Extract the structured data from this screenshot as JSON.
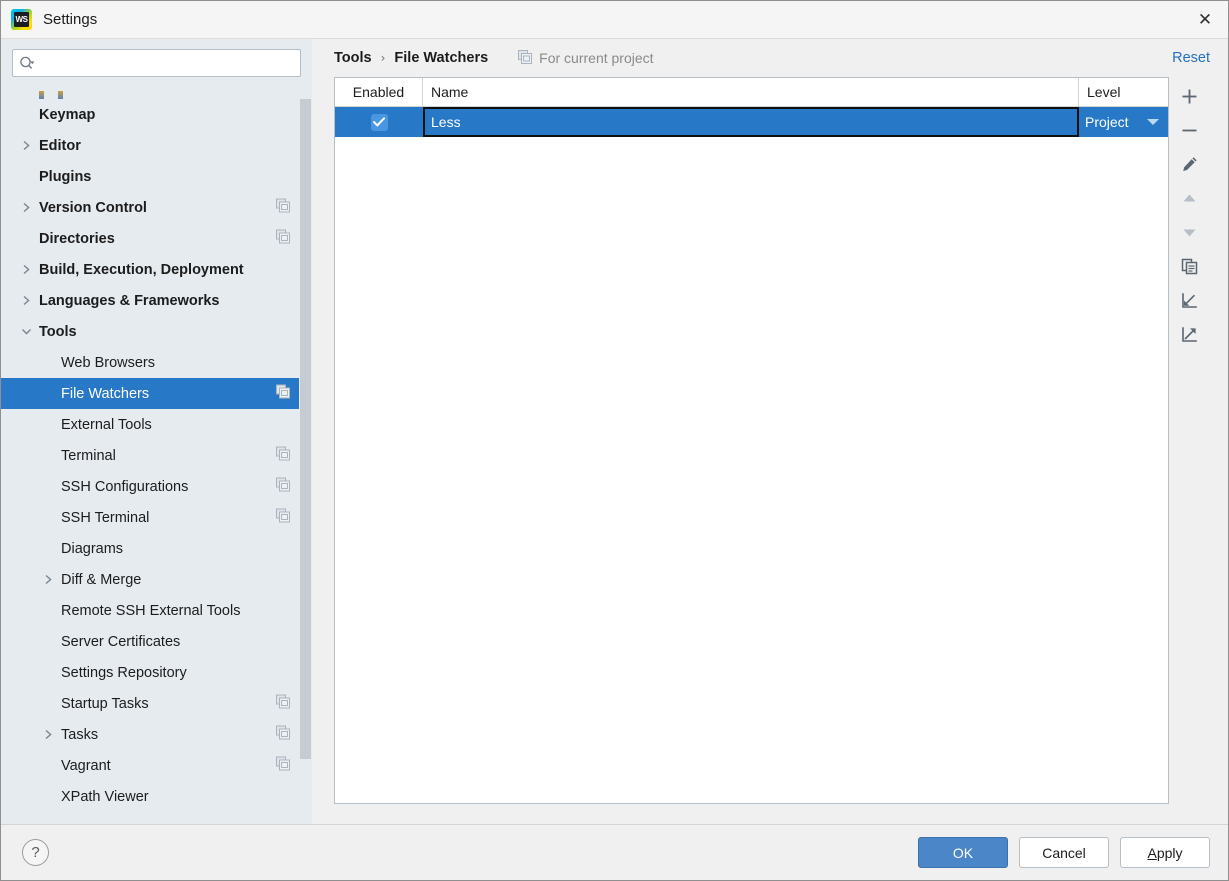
{
  "window": {
    "title": "Settings",
    "logo_text": "WS",
    "close_label": "✕"
  },
  "sidebar": {
    "search": {
      "value": "",
      "placeholder": ""
    },
    "items": [
      {
        "label": "Keymap",
        "level": 0,
        "bold": true,
        "arrow": "none",
        "copy": false
      },
      {
        "label": "Editor",
        "level": 0,
        "bold": true,
        "arrow": "right",
        "copy": false
      },
      {
        "label": "Plugins",
        "level": 0,
        "bold": true,
        "arrow": "none",
        "copy": false
      },
      {
        "label": "Version Control",
        "level": 0,
        "bold": true,
        "arrow": "right",
        "copy": true
      },
      {
        "label": "Directories",
        "level": 0,
        "bold": true,
        "arrow": "none",
        "copy": true
      },
      {
        "label": "Build, Execution, Deployment",
        "level": 0,
        "bold": true,
        "arrow": "right",
        "copy": false
      },
      {
        "label": "Languages & Frameworks",
        "level": 0,
        "bold": true,
        "arrow": "right",
        "copy": false
      },
      {
        "label": "Tools",
        "level": 0,
        "bold": true,
        "arrow": "down",
        "copy": false
      },
      {
        "label": "Web Browsers",
        "level": 1,
        "bold": false,
        "arrow": "none",
        "copy": false
      },
      {
        "label": "File Watchers",
        "level": 1,
        "bold": false,
        "arrow": "none",
        "copy": true,
        "selected": true
      },
      {
        "label": "External Tools",
        "level": 1,
        "bold": false,
        "arrow": "none",
        "copy": false
      },
      {
        "label": "Terminal",
        "level": 1,
        "bold": false,
        "arrow": "none",
        "copy": true
      },
      {
        "label": "SSH Configurations",
        "level": 1,
        "bold": false,
        "arrow": "none",
        "copy": true
      },
      {
        "label": "SSH Terminal",
        "level": 1,
        "bold": false,
        "arrow": "none",
        "copy": true
      },
      {
        "label": "Diagrams",
        "level": 1,
        "bold": false,
        "arrow": "none",
        "copy": false
      },
      {
        "label": "Diff & Merge",
        "level": 1,
        "bold": false,
        "arrow": "right",
        "copy": false
      },
      {
        "label": "Remote SSH External Tools",
        "level": 1,
        "bold": false,
        "arrow": "none",
        "copy": false
      },
      {
        "label": "Server Certificates",
        "level": 1,
        "bold": false,
        "arrow": "none",
        "copy": false
      },
      {
        "label": "Settings Repository",
        "level": 1,
        "bold": false,
        "arrow": "none",
        "copy": false
      },
      {
        "label": "Startup Tasks",
        "level": 1,
        "bold": false,
        "arrow": "none",
        "copy": true
      },
      {
        "label": "Tasks",
        "level": 1,
        "bold": false,
        "arrow": "right",
        "copy": true
      },
      {
        "label": "Vagrant",
        "level": 1,
        "bold": false,
        "arrow": "none",
        "copy": true
      },
      {
        "label": "XPath Viewer",
        "level": 1,
        "bold": false,
        "arrow": "none",
        "copy": false
      }
    ]
  },
  "header": {
    "breadcrumb_root": "Tools",
    "breadcrumb_sep": "›",
    "breadcrumb_current": "File Watchers",
    "scope_note": "For current project",
    "reset_label": "Reset"
  },
  "table": {
    "columns": [
      "Enabled",
      "Name",
      "Level"
    ],
    "rows": [
      {
        "enabled": true,
        "name": "Less",
        "level": "Project",
        "selected": true
      }
    ]
  },
  "toolbar": {
    "buttons": [
      {
        "name": "add",
        "glyph": "+",
        "enabled": true
      },
      {
        "name": "remove",
        "glyph": "−",
        "enabled": true
      },
      {
        "name": "edit",
        "glyph": "pencil",
        "enabled": true
      },
      {
        "name": "move-up",
        "glyph": "▲",
        "enabled": false
      },
      {
        "name": "move-down",
        "glyph": "▼",
        "enabled": false
      },
      {
        "name": "copy",
        "glyph": "copy",
        "enabled": true
      },
      {
        "name": "import",
        "glyph": "import",
        "enabled": true
      },
      {
        "name": "export",
        "glyph": "export",
        "enabled": true
      }
    ]
  },
  "footer": {
    "help_label": "?",
    "ok_label": "OK",
    "cancel_label": "Cancel",
    "apply_mnemonic": "A",
    "apply_rest": "pply"
  },
  "colors": {
    "accent_blue": "#2878c8",
    "link_blue": "#2470c0",
    "sidebar_bg": "#e6ebf0",
    "primary_btn": "#4a86c8"
  }
}
